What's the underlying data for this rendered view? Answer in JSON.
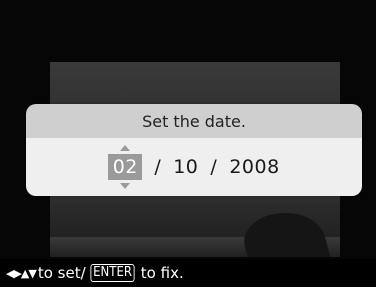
{
  "dialog": {
    "title": "Set the date.",
    "date": {
      "month": "02",
      "day": "10",
      "year": "2008",
      "separator": "/"
    }
  },
  "footer": {
    "arrows_glyph": "◀▶▲▼",
    "to_set": "to set/",
    "enter_label": "ENTER",
    "to_fix": "to fix."
  },
  "colors": {
    "background": "#000000",
    "dialog_header": "#cfcfcf",
    "dialog_body": "#efefef",
    "selected_field": "#9a9a9a"
  }
}
